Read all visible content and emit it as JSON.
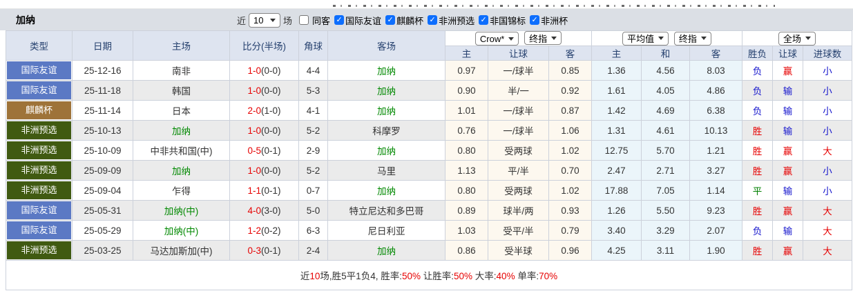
{
  "top_bar": {
    "title": "加纳",
    "recent_label": "近",
    "recent_select": "10",
    "matches_label": "场",
    "checkboxes": [
      {
        "label": "同客",
        "checked": false
      },
      {
        "label": "国际友谊",
        "checked": true
      },
      {
        "label": "麒麟杯",
        "checked": true
      },
      {
        "label": "非洲预选",
        "checked": true
      },
      {
        "label": "非国锦标",
        "checked": true
      },
      {
        "label": "非洲杯",
        "checked": true
      }
    ]
  },
  "selects": {
    "ah_source": "Crow*",
    "ah_stage": "终指",
    "eu_source": "平均值",
    "eu_stage": "终指",
    "scope": "全场"
  },
  "columns": {
    "type": "类型",
    "date": "日期",
    "home": "主场",
    "score": "比分(半场)",
    "corner": "角球",
    "away": "客场",
    "ah_home": "主",
    "ah_line": "让球",
    "ah_away": "客",
    "eu_home": "主",
    "eu_draw": "和",
    "eu_away": "客",
    "wl": "胜负",
    "handicap": "让球",
    "goals": "进球数"
  },
  "table": {
    "rows": [
      {
        "type": "国际友谊",
        "date": "25-12-16",
        "home": "南非",
        "home_green": false,
        "score": "1-0",
        "half": "(0-0)",
        "corner": "4-4",
        "away": "加纳",
        "away_green": true,
        "ah": [
          "0.97",
          "一/球半",
          "0.85"
        ],
        "eu": [
          "1.36",
          "4.56",
          "8.03"
        ],
        "results": [
          "负",
          "赢",
          "小"
        ]
      },
      {
        "type": "国际友谊",
        "date": "25-11-18",
        "home": "韩国",
        "home_green": false,
        "score": "1-0",
        "half": "(0-0)",
        "corner": "5-3",
        "away": "加纳",
        "away_green": true,
        "ah": [
          "0.90",
          "半/一",
          "0.92"
        ],
        "eu": [
          "1.61",
          "4.05",
          "4.86"
        ],
        "results": [
          "负",
          "输",
          "小"
        ]
      },
      {
        "type": "麒麟杯",
        "date": "25-11-14",
        "home": "日本",
        "home_green": false,
        "score": "2-0",
        "half": "(1-0)",
        "corner": "4-1",
        "away": "加纳",
        "away_green": true,
        "ah": [
          "1.01",
          "一/球半",
          "0.87"
        ],
        "eu": [
          "1.42",
          "4.69",
          "6.38"
        ],
        "results": [
          "负",
          "输",
          "小"
        ]
      },
      {
        "type": "非洲预选",
        "date": "25-10-13",
        "home": "加纳",
        "home_green": true,
        "score": "1-0",
        "half": "(0-0)",
        "corner": "5-2",
        "away": "科摩罗",
        "away_green": false,
        "ah": [
          "0.76",
          "一/球半",
          "1.06"
        ],
        "eu": [
          "1.31",
          "4.61",
          "10.13"
        ],
        "results": [
          "胜",
          "输",
          "小"
        ]
      },
      {
        "type": "非洲预选",
        "date": "25-10-09",
        "home": "中非共和国(中)",
        "home_green": false,
        "score": "0-5",
        "half": "(0-1)",
        "corner": "2-9",
        "away": "加纳",
        "away_green": true,
        "ah": [
          "0.80",
          "受两球",
          "1.02"
        ],
        "eu": [
          "12.75",
          "5.70",
          "1.21"
        ],
        "results": [
          "胜",
          "赢",
          "大"
        ]
      },
      {
        "type": "非洲预选",
        "date": "25-09-09",
        "home": "加纳",
        "home_green": true,
        "score": "1-0",
        "half": "(0-0)",
        "corner": "5-2",
        "away": "马里",
        "away_green": false,
        "ah": [
          "1.13",
          "平/半",
          "0.70"
        ],
        "eu": [
          "2.47",
          "2.71",
          "3.27"
        ],
        "results": [
          "胜",
          "赢",
          "小"
        ]
      },
      {
        "type": "非洲预选",
        "date": "25-09-04",
        "home": "乍得",
        "home_green": false,
        "score": "1-1",
        "half": "(0-1)",
        "corner": "0-7",
        "away": "加纳",
        "away_green": true,
        "ah": [
          "0.80",
          "受两球",
          "1.02"
        ],
        "eu": [
          "17.88",
          "7.05",
          "1.14"
        ],
        "results": [
          "平",
          "输",
          "小"
        ]
      },
      {
        "type": "国际友谊",
        "date": "25-05-31",
        "home": "加纳(中)",
        "home_green": true,
        "score": "4-0",
        "half": "(3-0)",
        "corner": "5-0",
        "away": "特立尼达和多巴哥",
        "away_green": false,
        "ah": [
          "0.89",
          "球半/两",
          "0.93"
        ],
        "eu": [
          "1.26",
          "5.50",
          "9.23"
        ],
        "results": [
          "胜",
          "赢",
          "大"
        ]
      },
      {
        "type": "国际友谊",
        "date": "25-05-29",
        "home": "加纳(中)",
        "home_green": true,
        "score": "1-2",
        "half": "(0-2)",
        "corner": "6-3",
        "away": "尼日利亚",
        "away_green": false,
        "ah": [
          "1.03",
          "受平/半",
          "0.79"
        ],
        "eu": [
          "3.40",
          "3.29",
          "2.07"
        ],
        "results": [
          "负",
          "输",
          "大"
        ]
      },
      {
        "type": "非洲预选",
        "date": "25-03-25",
        "home": "马达加斯加(中)",
        "home_green": false,
        "score": "0-3",
        "half": "(0-1)",
        "corner": "2-4",
        "away": "加纳",
        "away_green": true,
        "ah": [
          "0.86",
          "受半球",
          "0.96"
        ],
        "eu": [
          "4.25",
          "3.11",
          "1.90"
        ],
        "results": [
          "胜",
          "赢",
          "大"
        ]
      }
    ]
  },
  "footer": {
    "segments": [
      {
        "text": "近",
        "red": false
      },
      {
        "text": "10",
        "red": true
      },
      {
        "text": "场,胜5平1负4, 胜率:",
        "red": false
      },
      {
        "text": "50%",
        "red": true
      },
      {
        "text": " 让胜率:",
        "red": false
      },
      {
        "text": "50%",
        "red": true
      },
      {
        "text": " 大率:",
        "red": false
      },
      {
        "text": "40%",
        "red": true
      },
      {
        "text": " 单率:",
        "red": false
      },
      {
        "text": "70%",
        "red": true
      }
    ]
  },
  "colors": {
    "red": "#e60000",
    "blue": "#1414cc",
    "green": "#008000",
    "team_green": "#008800",
    "checkbox_blue": "#0d6efd",
    "header_bg": "#dee4f0",
    "alt_row_bg": "#ebebeb",
    "ah_col_bg": "#fdf8ef",
    "eu_col_bg": "#ebf5fa",
    "type_colors": {
      "国际友谊": "#5b79c4",
      "麒麟杯": "#9e7339",
      "非洲预选": "#405a11"
    }
  },
  "result_colors": {
    "胜": "c-red",
    "平": "c-green",
    "负": "c-blue",
    "赢": "c-red",
    "输": "c-blue",
    "大": "c-red",
    "小": "c-blue"
  }
}
